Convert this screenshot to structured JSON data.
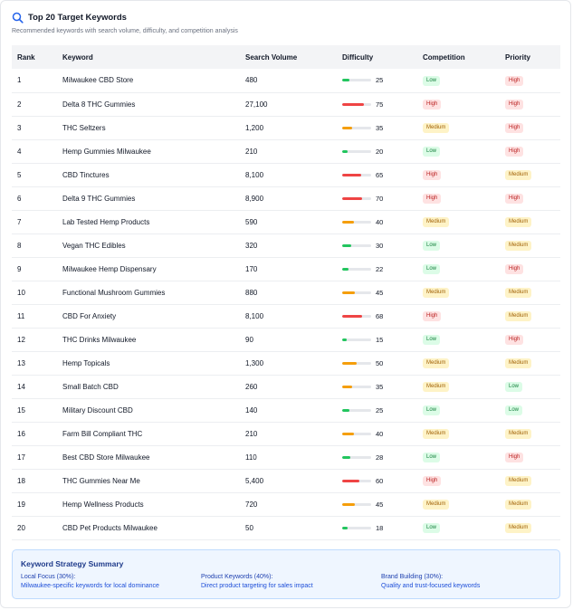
{
  "header": {
    "title": "Top 20 Target Keywords",
    "subtitle": "Recommended keywords with search volume, difficulty, and competition analysis",
    "icon": "search-icon"
  },
  "columns": [
    "Rank",
    "Keyword",
    "Search Volume",
    "Difficulty",
    "Competition",
    "Priority"
  ],
  "colors": {
    "low": "#22c55e",
    "medium": "#f59e0b",
    "high": "#ef4444"
  },
  "rows": [
    {
      "rank": "1",
      "keyword": "Milwaukee CBD Store",
      "volume": "480",
      "difficulty": 25,
      "competition": "Low",
      "priority": "High"
    },
    {
      "rank": "2",
      "keyword": "Delta 8 THC Gummies",
      "volume": "27,100",
      "difficulty": 75,
      "competition": "High",
      "priority": "High"
    },
    {
      "rank": "3",
      "keyword": "THC Seltzers",
      "volume": "1,200",
      "difficulty": 35,
      "competition": "Medium",
      "priority": "High"
    },
    {
      "rank": "4",
      "keyword": "Hemp Gummies Milwaukee",
      "volume": "210",
      "difficulty": 20,
      "competition": "Low",
      "priority": "High"
    },
    {
      "rank": "5",
      "keyword": "CBD Tinctures",
      "volume": "8,100",
      "difficulty": 65,
      "competition": "High",
      "priority": "Medium"
    },
    {
      "rank": "6",
      "keyword": "Delta 9 THC Gummies",
      "volume": "8,900",
      "difficulty": 70,
      "competition": "High",
      "priority": "High"
    },
    {
      "rank": "7",
      "keyword": "Lab Tested Hemp Products",
      "volume": "590",
      "difficulty": 40,
      "competition": "Medium",
      "priority": "Medium"
    },
    {
      "rank": "8",
      "keyword": "Vegan THC Edibles",
      "volume": "320",
      "difficulty": 30,
      "competition": "Low",
      "priority": "Medium"
    },
    {
      "rank": "9",
      "keyword": "Milwaukee Hemp Dispensary",
      "volume": "170",
      "difficulty": 22,
      "competition": "Low",
      "priority": "High"
    },
    {
      "rank": "10",
      "keyword": "Functional Mushroom Gummies",
      "volume": "880",
      "difficulty": 45,
      "competition": "Medium",
      "priority": "Medium"
    },
    {
      "rank": "11",
      "keyword": "CBD For Anxiety",
      "volume": "8,100",
      "difficulty": 68,
      "competition": "High",
      "priority": "Medium"
    },
    {
      "rank": "12",
      "keyword": "THC Drinks Milwaukee",
      "volume": "90",
      "difficulty": 15,
      "competition": "Low",
      "priority": "High"
    },
    {
      "rank": "13",
      "keyword": "Hemp Topicals",
      "volume": "1,300",
      "difficulty": 50,
      "competition": "Medium",
      "priority": "Medium"
    },
    {
      "rank": "14",
      "keyword": "Small Batch CBD",
      "volume": "260",
      "difficulty": 35,
      "competition": "Medium",
      "priority": "Low"
    },
    {
      "rank": "15",
      "keyword": "Military Discount CBD",
      "volume": "140",
      "difficulty": 25,
      "competition": "Low",
      "priority": "Low"
    },
    {
      "rank": "16",
      "keyword": "Farm Bill Compliant THC",
      "volume": "210",
      "difficulty": 40,
      "competition": "Medium",
      "priority": "Medium"
    },
    {
      "rank": "17",
      "keyword": "Best CBD Store Milwaukee",
      "volume": "110",
      "difficulty": 28,
      "competition": "Low",
      "priority": "High"
    },
    {
      "rank": "18",
      "keyword": "THC Gummies Near Me",
      "volume": "5,400",
      "difficulty": 60,
      "competition": "High",
      "priority": "Medium"
    },
    {
      "rank": "19",
      "keyword": "Hemp Wellness Products",
      "volume": "720",
      "difficulty": 45,
      "competition": "Medium",
      "priority": "Medium"
    },
    {
      "rank": "20",
      "keyword": "CBD Pet Products Milwaukee",
      "volume": "50",
      "difficulty": 18,
      "competition": "Low",
      "priority": "Medium"
    }
  ],
  "summary": {
    "title": "Keyword Strategy Summary",
    "items": [
      {
        "heading": "Local Focus (30%):",
        "text": "Milwaukee-specific keywords for local dominance"
      },
      {
        "heading": "Product Keywords (40%):",
        "text": "Direct product targeting for sales impact"
      },
      {
        "heading": "Brand Building (30%):",
        "text": "Quality and trust-focused keywords"
      }
    ]
  }
}
